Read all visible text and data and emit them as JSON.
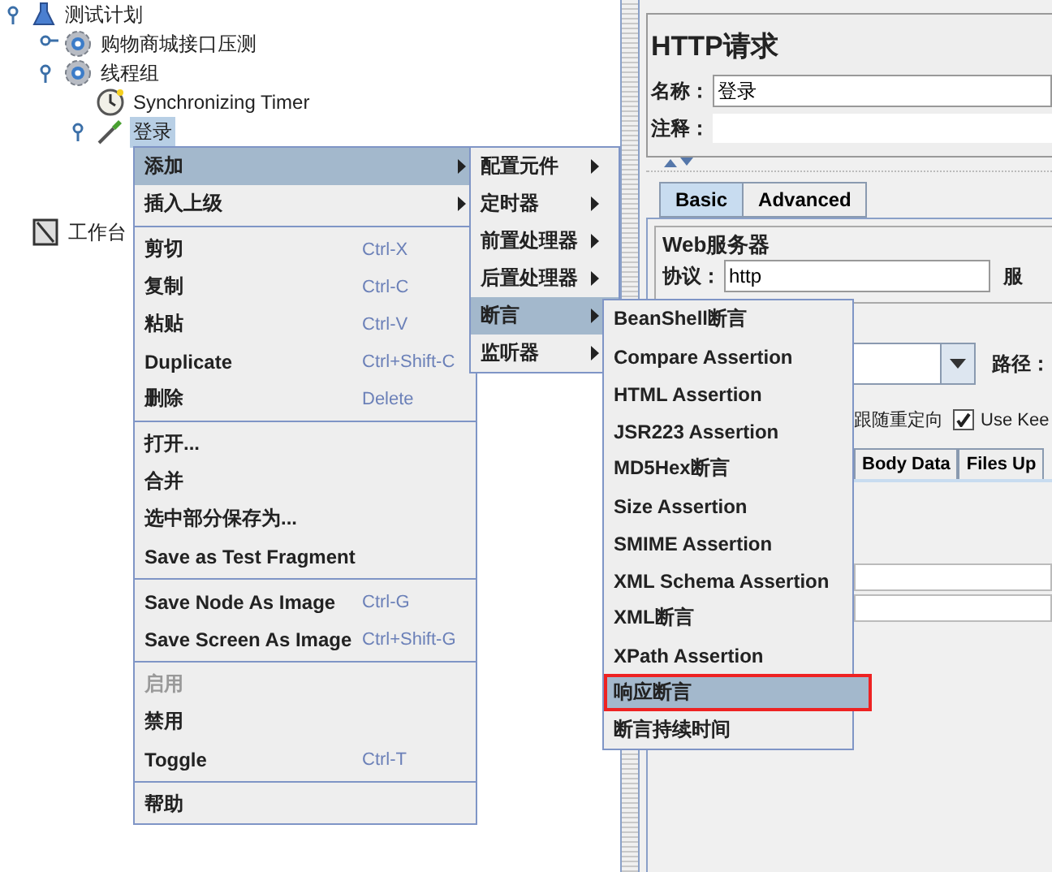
{
  "tree": [
    {
      "label": "测试计划",
      "kind": "plan",
      "expanded": true,
      "selected": false,
      "children": [
        {
          "label": "购物商城接口压测",
          "kind": "group",
          "expanded": false,
          "selected": false
        },
        {
          "label": "线程组",
          "kind": "group",
          "expanded": true,
          "selected": false,
          "children": [
            {
              "label": "Synchronizing Timer",
              "kind": "timer",
              "selected": false
            },
            {
              "label": "登录",
              "kind": "sampler",
              "expanded": true,
              "selected": true
            }
          ]
        }
      ]
    },
    {
      "label": "工作台",
      "kind": "workbench",
      "selected": false
    }
  ],
  "editor": {
    "title": "HTTP请求",
    "name_label": "名称：",
    "name_value": "登录",
    "comment_label": "注释：",
    "tabs": [
      {
        "label": "Basic",
        "selected": true
      },
      {
        "label": "Advanced",
        "selected": false
      }
    ],
    "group_title": "Web服务器",
    "protocol_label": "协议：",
    "protocol_value": "http",
    "server_label_cut": "服",
    "path_label": "路径：",
    "redirect_label": "跟随重定向",
    "keepalive": {
      "label": "Use Kee",
      "checked": true
    },
    "body_tabs": [
      {
        "label": "Body Data",
        "selected": false
      },
      {
        "label": "Files Up",
        "selected": false
      }
    ]
  },
  "context_menu": [
    {
      "kind": "item",
      "label": "添加",
      "submenu": true,
      "selected": true,
      "disabled": false
    },
    {
      "kind": "item",
      "label": "插入上级",
      "submenu": true,
      "selected": false,
      "disabled": false
    },
    {
      "kind": "separator"
    },
    {
      "kind": "item",
      "label": "剪切",
      "shortcut": "Ctrl-X",
      "submenu": false,
      "selected": false,
      "disabled": false
    },
    {
      "kind": "item",
      "label": "复制",
      "shortcut": "Ctrl-C",
      "submenu": false,
      "selected": false,
      "disabled": false
    },
    {
      "kind": "item",
      "label": "粘贴",
      "shortcut": "Ctrl-V",
      "submenu": false,
      "selected": false,
      "disabled": false
    },
    {
      "kind": "item",
      "label": "Duplicate",
      "shortcut": "Ctrl+Shift-C",
      "submenu": false,
      "selected": false,
      "disabled": false
    },
    {
      "kind": "item",
      "label": "删除",
      "shortcut": "Delete",
      "submenu": false,
      "selected": false,
      "disabled": false
    },
    {
      "kind": "separator"
    },
    {
      "kind": "item",
      "label": "打开...",
      "submenu": false,
      "selected": false,
      "disabled": false
    },
    {
      "kind": "item",
      "label": "合并",
      "submenu": false,
      "selected": false,
      "disabled": false
    },
    {
      "kind": "item",
      "label": "选中部分保存为...",
      "submenu": false,
      "selected": false,
      "disabled": false
    },
    {
      "kind": "item",
      "label": "Save as Test Fragment",
      "submenu": false,
      "selected": false,
      "disabled": false
    },
    {
      "kind": "separator"
    },
    {
      "kind": "item",
      "label": "Save Node As Image",
      "shortcut": "Ctrl-G",
      "submenu": false,
      "selected": false,
      "disabled": false
    },
    {
      "kind": "item",
      "label": "Save Screen As Image",
      "shortcut": "Ctrl+Shift-G",
      "submenu": false,
      "selected": false,
      "disabled": false
    },
    {
      "kind": "separator"
    },
    {
      "kind": "item",
      "label": "启用",
      "submenu": false,
      "selected": false,
      "disabled": true
    },
    {
      "kind": "item",
      "label": "禁用",
      "submenu": false,
      "selected": false,
      "disabled": false
    },
    {
      "kind": "item",
      "label": "Toggle",
      "shortcut": "Ctrl-T",
      "submenu": false,
      "selected": false,
      "disabled": false
    },
    {
      "kind": "separator"
    },
    {
      "kind": "item",
      "label": "帮助",
      "submenu": false,
      "selected": false,
      "disabled": false
    }
  ],
  "add_submenu": [
    {
      "label": "配置元件",
      "submenu": true,
      "selected": false
    },
    {
      "label": "定时器",
      "submenu": true,
      "selected": false
    },
    {
      "label": "前置处理器",
      "submenu": true,
      "selected": false
    },
    {
      "label": "后置处理器",
      "submenu": true,
      "selected": false
    },
    {
      "label": "断言",
      "submenu": true,
      "selected": true
    },
    {
      "label": "监听器",
      "submenu": true,
      "selected": false
    }
  ],
  "assertion_submenu": [
    {
      "label": "BeanShell断言",
      "selected": false,
      "outlined": false
    },
    {
      "label": "Compare Assertion",
      "selected": false,
      "outlined": false
    },
    {
      "label": "HTML Assertion",
      "selected": false,
      "outlined": false
    },
    {
      "label": "JSR223 Assertion",
      "selected": false,
      "outlined": false
    },
    {
      "label": "MD5Hex断言",
      "selected": false,
      "outlined": false
    },
    {
      "label": "Size Assertion",
      "selected": false,
      "outlined": false
    },
    {
      "label": "SMIME Assertion",
      "selected": false,
      "outlined": false
    },
    {
      "label": "XML Schema Assertion",
      "selected": false,
      "outlined": false
    },
    {
      "label": "XML断言",
      "selected": false,
      "outlined": false
    },
    {
      "label": "XPath Assertion",
      "selected": false,
      "outlined": false
    },
    {
      "label": "响应断言",
      "selected": true,
      "outlined": true
    },
    {
      "label": "断言持续时间",
      "selected": false,
      "outlined": false
    }
  ]
}
